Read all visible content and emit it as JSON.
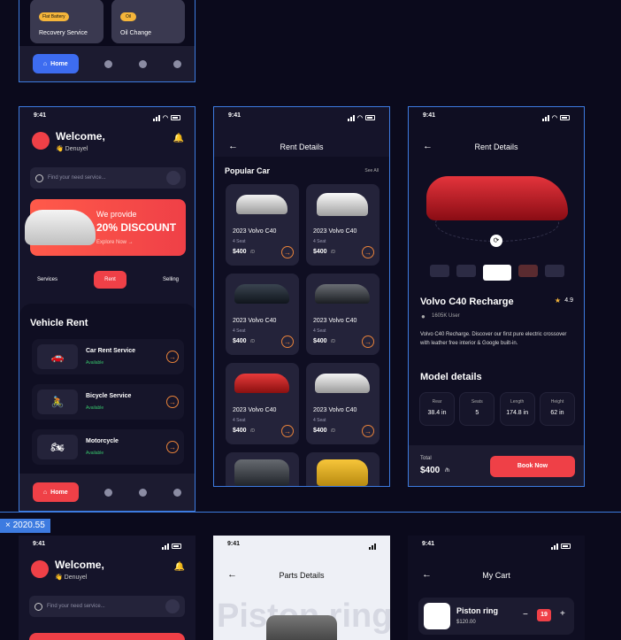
{
  "colors": {
    "accent": "#ef4047",
    "blue": "#3d6cf0",
    "green": "#37c36b",
    "bg": "#0b0a1c"
  },
  "top": {
    "cards": [
      {
        "badge": "Flat Battery",
        "label": "Recovery Service"
      },
      {
        "badge": "Oil",
        "label": "Oil Change"
      }
    ],
    "nav_home": "Home"
  },
  "status_time": "9:41",
  "home": {
    "welcome": "Welcome,",
    "user": "👋 Denuyel",
    "search_placeholder": "Find your need service...",
    "promo_line1": "We provide",
    "promo_line2": "20% DISCOUNT",
    "promo_cta": "Explore Now →",
    "tabs": [
      "Services",
      "Rent",
      "Selling"
    ],
    "section": "Vehicle Rent",
    "services": [
      {
        "name": "Car Rent Service",
        "status": "Available"
      },
      {
        "name": "Bicycle Service",
        "status": "Available"
      },
      {
        "name": "Motorcycle",
        "status": "Available"
      }
    ],
    "nav_home": "Home"
  },
  "rent": {
    "title": "Rent Details",
    "section": "Popular Car",
    "see_all": "See All",
    "cars": [
      {
        "name": "2023 Volvo C40",
        "seat": "4 Seat",
        "price": "$400",
        "unit": "/D"
      },
      {
        "name": "2023 Volvo C40",
        "seat": "4 Seat",
        "price": "$400",
        "unit": "/D"
      },
      {
        "name": "2023 Volvo C40",
        "seat": "4 Seat",
        "price": "$400",
        "unit": "/D"
      },
      {
        "name": "2023 Volvo C40",
        "seat": "4 Seat",
        "price": "$400",
        "unit": "/D"
      },
      {
        "name": "2023 Volvo C40",
        "seat": "4 Seat",
        "price": "$400",
        "unit": "/D"
      },
      {
        "name": "2023 Volvo C40",
        "seat": "4 Seat",
        "price": "$400",
        "unit": "/D"
      }
    ]
  },
  "detail": {
    "title": "Rent Details",
    "car": "Volvo C40 Recharge",
    "rating": "4.9",
    "users": "1605K User",
    "desc": "Volvo C40 Recharge. Discover our first pure electric crossover with leather free interior & Google built-in.",
    "model_title": "Model details",
    "specs": [
      {
        "k": "Rear",
        "v": "38.4 in"
      },
      {
        "k": "Seats",
        "v": "5"
      },
      {
        "k": "Length",
        "v": "174.8 in"
      },
      {
        "k": "Height",
        "v": "62 in"
      }
    ],
    "total_label": "Total",
    "total": "$400",
    "total_unit": "/h",
    "cta": "Book Now"
  },
  "badge_label": "× 2020.55",
  "bottom": {
    "welcome": "Welcome,",
    "user": "👋 Denuyel",
    "search_placeholder": "Find your need service...",
    "parts_title": "Parts Details",
    "parts_bg": "Piston ring",
    "cart_title": "My Cart",
    "cart_item": "Piston ring",
    "cart_price": "$120.00",
    "cart_qty": "19"
  }
}
